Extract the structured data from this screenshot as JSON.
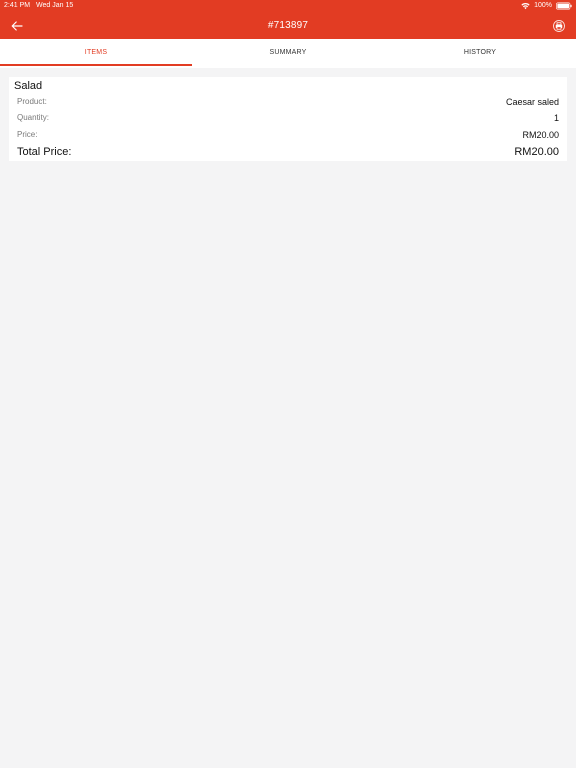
{
  "status_bar": {
    "time": "2:41 PM",
    "date": "Wed Jan 15",
    "battery": "100%"
  },
  "header": {
    "title": "#713897",
    "back_icon": "arrow-left-icon",
    "print_icon": "printer-icon"
  },
  "tabs": [
    {
      "label": "ITEMS",
      "active": true
    },
    {
      "label": "SUMMARY",
      "active": false
    },
    {
      "label": "HISTORY",
      "active": false
    }
  ],
  "item": {
    "title": "Salad",
    "rows": [
      {
        "label": "Product:",
        "value": "Caesar saled"
      },
      {
        "label": "Quantity:",
        "value": "1"
      },
      {
        "label": "Price:",
        "value": "RM20.00"
      }
    ],
    "total_label": "Total Price:",
    "total_value": "RM20.00"
  },
  "colors": {
    "accent": "#e23c23",
    "background": "#f4f4f5",
    "card": "#ffffff"
  }
}
